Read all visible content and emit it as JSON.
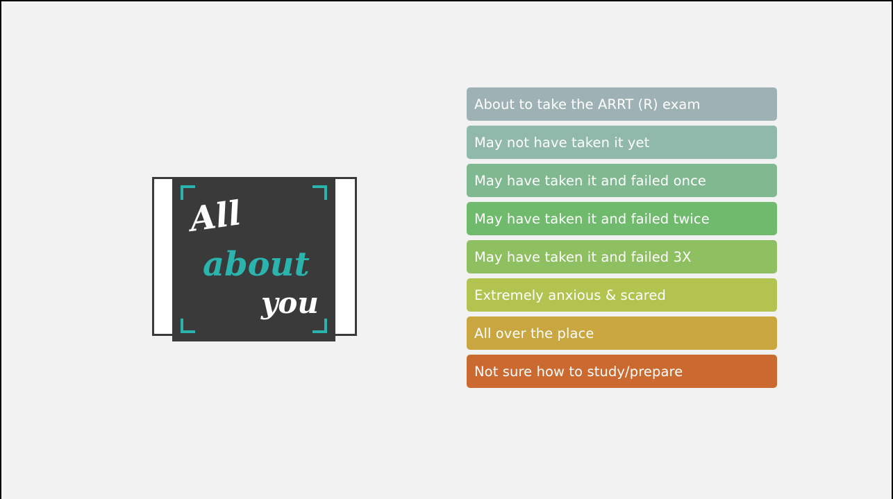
{
  "logo": {
    "word1": "All",
    "word2": "about",
    "word3": "you",
    "colors": {
      "tile": "#3a3a3a",
      "bracket": "#2bb3ad",
      "accent_text": "#2bb3ad",
      "light_text": "#ffffff"
    }
  },
  "list": {
    "items": [
      {
        "label": "About to take the ARRT (R) exam",
        "color": "#9eb2b5"
      },
      {
        "label": "May not have taken it yet",
        "color": "#90b9ac"
      },
      {
        "label": "May have taken it and failed once",
        "color": "#80b98f"
      },
      {
        "label": "May have taken it and failed twice",
        "color": "#6fba6d"
      },
      {
        "label": "May have taken it and failed 3X",
        "color": "#8ebf60"
      },
      {
        "label": "Extremely anxious & scared",
        "color": "#b2c44f"
      },
      {
        "label": "All over the place",
        "color": "#c9a640"
      },
      {
        "label": "Not sure how to study/prepare",
        "color": "#cb6a30"
      }
    ]
  }
}
